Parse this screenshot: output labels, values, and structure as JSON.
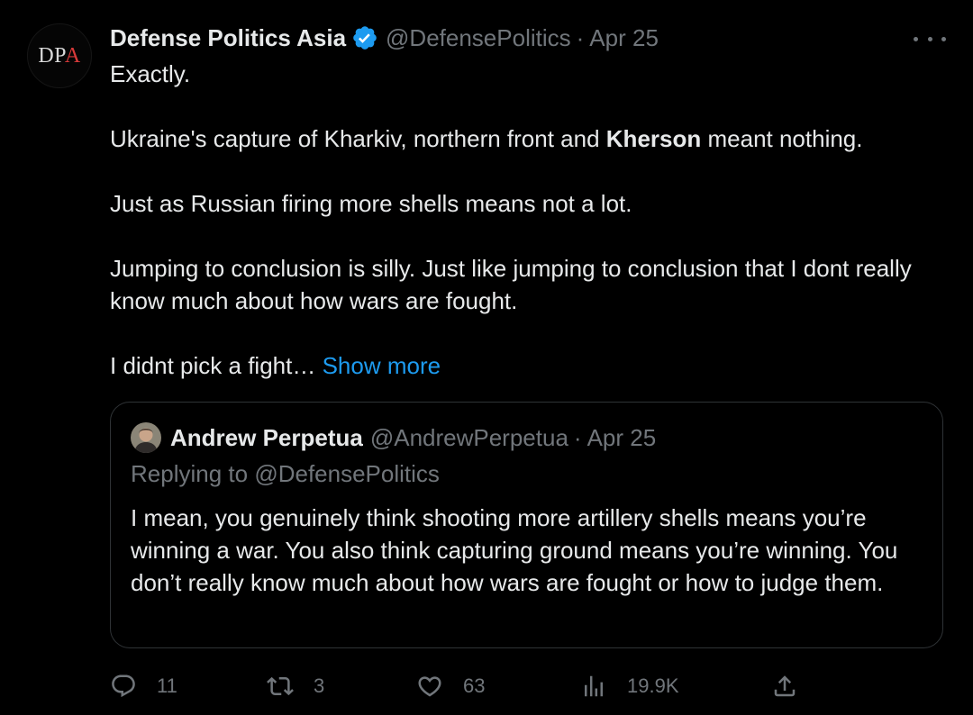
{
  "author": {
    "avatar_text": "DPA",
    "name": "Defense Politics Asia",
    "handle": "@DefensePolitics",
    "separator": "·",
    "date": "Apr 25",
    "verified": true
  },
  "tweet": {
    "paragraphs": [
      "Exactly.",
      "Ukraine's capture of Kharkiv, northern front and",
      "Kherson",
      "meant nothing.",
      "Just as Russian firing more shells means not a lot.",
      "Jumping to conclusion is silly. Just like jumping to conclusion that I dont really know much about how wars are fought.",
      "I didnt pick a fight…"
    ],
    "show_more": "Show more"
  },
  "quoted": {
    "name": "Andrew Perpetua",
    "handle": "@AndrewPerpetua",
    "separator": "·",
    "date": "Apr 25",
    "replying_label": "Replying to",
    "replying_handle": "@DefensePolitics",
    "text": "I mean, you genuinely think shooting more artillery shells means you’re winning a war. You also think capturing ground means you’re winning. You don’t really know much about how wars are fought or how to judge them."
  },
  "actions": {
    "replies": "11",
    "retweets": "3",
    "likes": "63",
    "views": "19.9K"
  },
  "icons": [
    "more-icon",
    "verified-badge-icon",
    "reply-icon",
    "retweet-icon",
    "like-icon",
    "views-icon",
    "share-icon"
  ],
  "colors": {
    "background": "#000000",
    "text": "#e7e9ea",
    "muted": "#71767b",
    "accent": "#1d9bf0",
    "border": "#2f3336"
  }
}
